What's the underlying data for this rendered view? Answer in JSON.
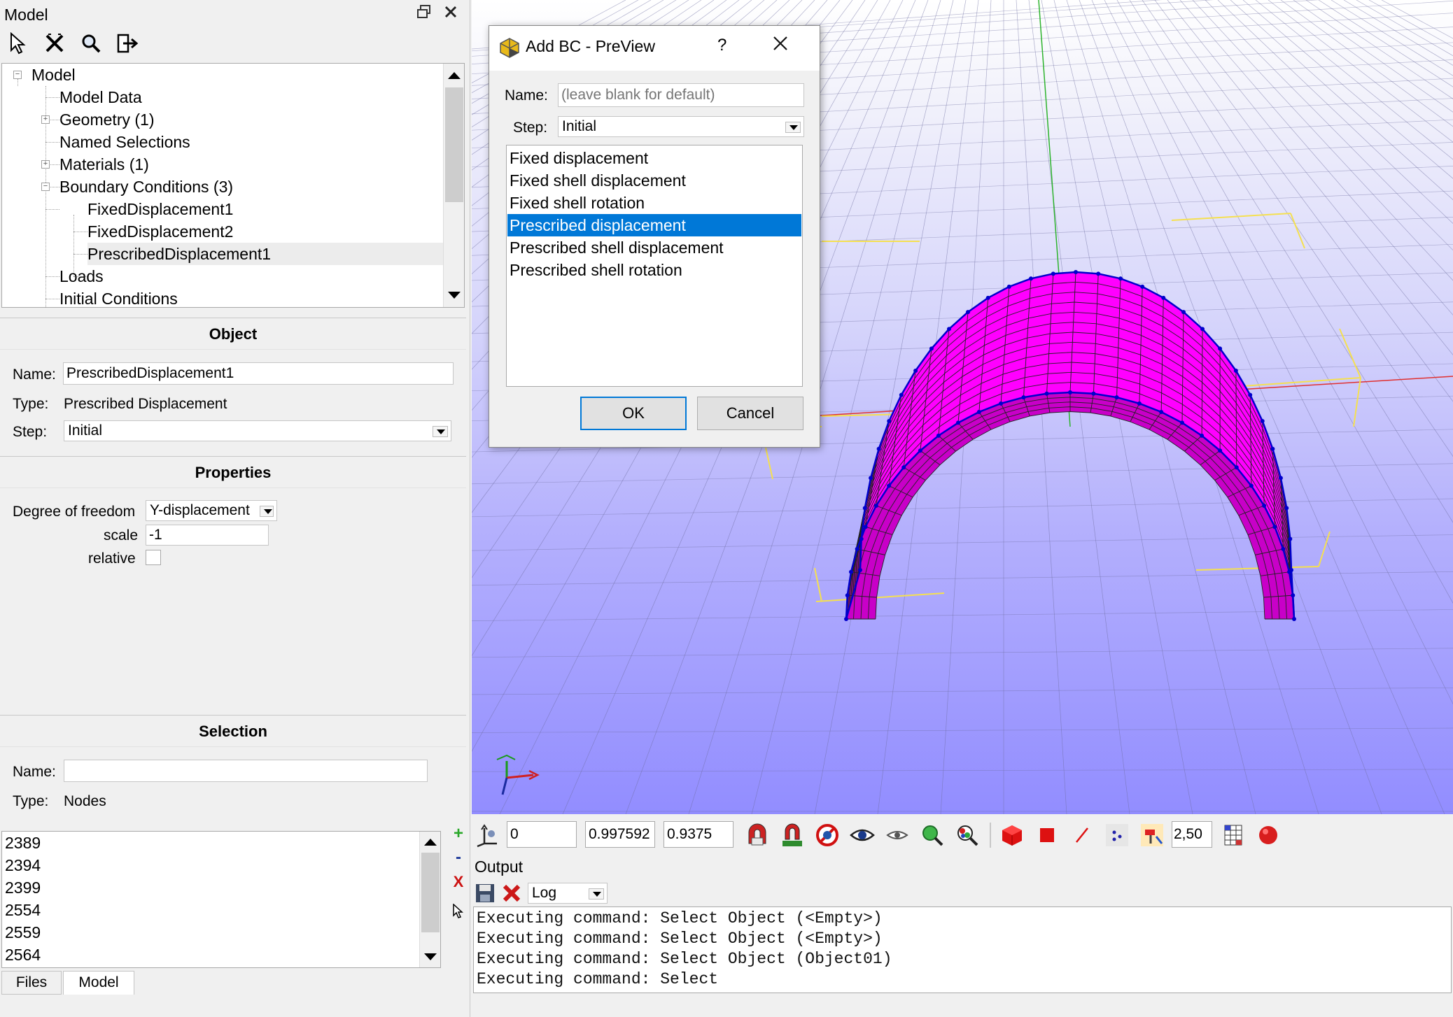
{
  "panel": {
    "title": "Model",
    "tree": [
      {
        "label": "Model"
      },
      {
        "label": "Model Data"
      },
      {
        "label": "Geometry (1)"
      },
      {
        "label": "Named Selections"
      },
      {
        "label": "Materials (1)"
      },
      {
        "label": "Boundary Conditions (3)"
      },
      {
        "label": "FixedDisplacement1"
      },
      {
        "label": "FixedDisplacement2"
      },
      {
        "label": "PrescribedDisplacement1"
      },
      {
        "label": "Loads"
      },
      {
        "label": "Initial Conditions"
      }
    ]
  },
  "object": {
    "heading": "Object",
    "name_label": "Name:",
    "name_value": "PrescribedDisplacement1",
    "type_label": "Type:",
    "type_value": "Prescribed Displacement",
    "step_label": "Step:",
    "step_value": "Initial"
  },
  "properties": {
    "heading": "Properties",
    "dof_label": "Degree of freedom",
    "dof_value": "Y-displacement",
    "scale_label": "scale",
    "scale_value": "-1",
    "relative_label": "relative",
    "relative_checked": false
  },
  "selection": {
    "heading": "Selection",
    "name_label": "Name:",
    "name_value": "",
    "type_label": "Type:",
    "type_value": "Nodes",
    "nodes": [
      "2389",
      "2394",
      "2399",
      "2554",
      "2559",
      "2564"
    ]
  },
  "side_tools": {
    "add": "+",
    "remove": "-",
    "clear": "X"
  },
  "bottom_tabs": [
    "Files",
    "Model"
  ],
  "view_toolbar": {
    "field1": "0",
    "field2": "0.997592",
    "field3": "0.9375",
    "spin": "2,50"
  },
  "output": {
    "title": "Output",
    "log_select": "Log",
    "lines": [
      "Executing command: Select Object (<Empty>)",
      "Executing command: Select Object (<Empty>)",
      "Executing command: Select Object (Object01)",
      "Executing command: Select"
    ]
  },
  "dialog": {
    "title": "Add BC - PreView",
    "help": "?",
    "name_label": "Name:",
    "name_placeholder": "(leave blank for default)",
    "step_label": "Step:",
    "step_value": "Initial",
    "bc_types": [
      "Fixed displacement",
      "Fixed shell displacement",
      "Fixed shell rotation",
      "Prescribed displacement",
      "Prescribed shell displacement",
      "Prescribed shell rotation"
    ],
    "selected_index": 3,
    "ok": "OK",
    "cancel": "Cancel"
  },
  "colors": {
    "mesh_fill": "#ff00ff",
    "mesh_edge": "#0000cc",
    "selection_highlight": "#0078d7",
    "bbox": "#f5e050"
  }
}
